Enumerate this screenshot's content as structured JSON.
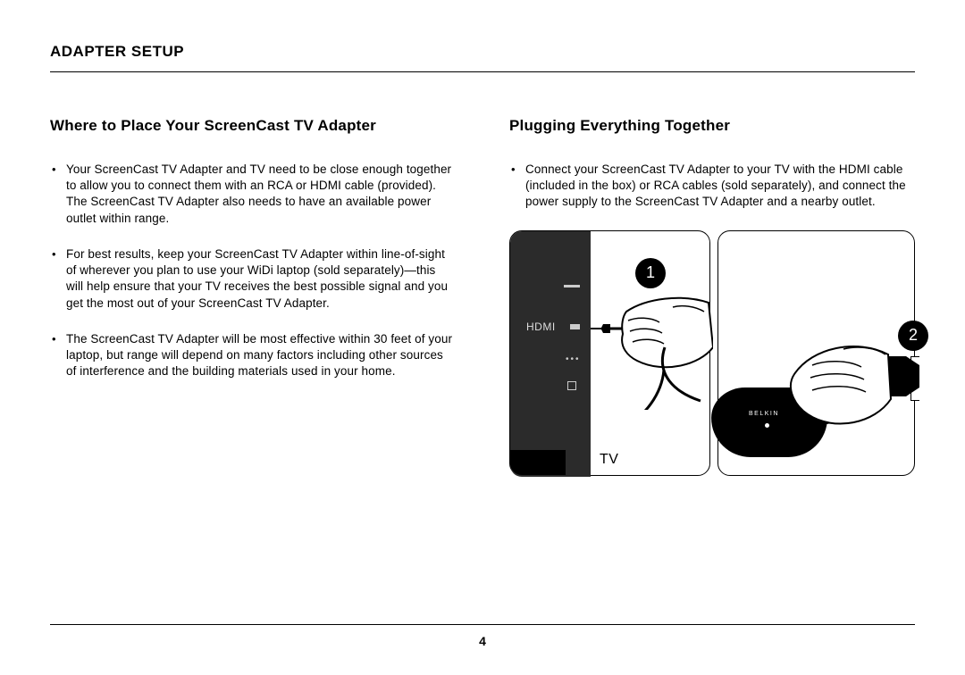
{
  "header": {
    "title": "ADAPTER SETUP"
  },
  "left": {
    "title": "Where to Place Your ScreenCast TV Adapter",
    "bullets": [
      "Your ScreenCast TV Adapter and TV need to be close enough together to allow you to connect them with an RCA or HDMI cable (provided). The ScreenCast TV Adapter also needs to have an available power outlet within range.",
      "For best results, keep your ScreenCast TV Adapter within line-of-sight of wherever you plan to use your WiDi laptop (sold separately)—this will help ensure that your TV receives the best possible signal and you get the most out of your ScreenCast TV Adapter.",
      "The ScreenCast TV Adapter will be most effective within 30 feet of your laptop, but range will depend on many factors including other sources of interference and the building materials used in your home."
    ]
  },
  "right": {
    "title": "Plugging Everything Together",
    "bullets": [
      "Connect your ScreenCast TV Adapter to your TV with the HDMI cable (included in the box) or RCA cables (sold separately), and connect the power supply to the ScreenCast TV Adapter and a nearby outlet."
    ],
    "diagram": {
      "step1": "1",
      "step2": "2",
      "hdmi_label": "HDMI",
      "tv_label": "TV",
      "adapter_brand": "BELKIN"
    }
  },
  "page_number": "4"
}
